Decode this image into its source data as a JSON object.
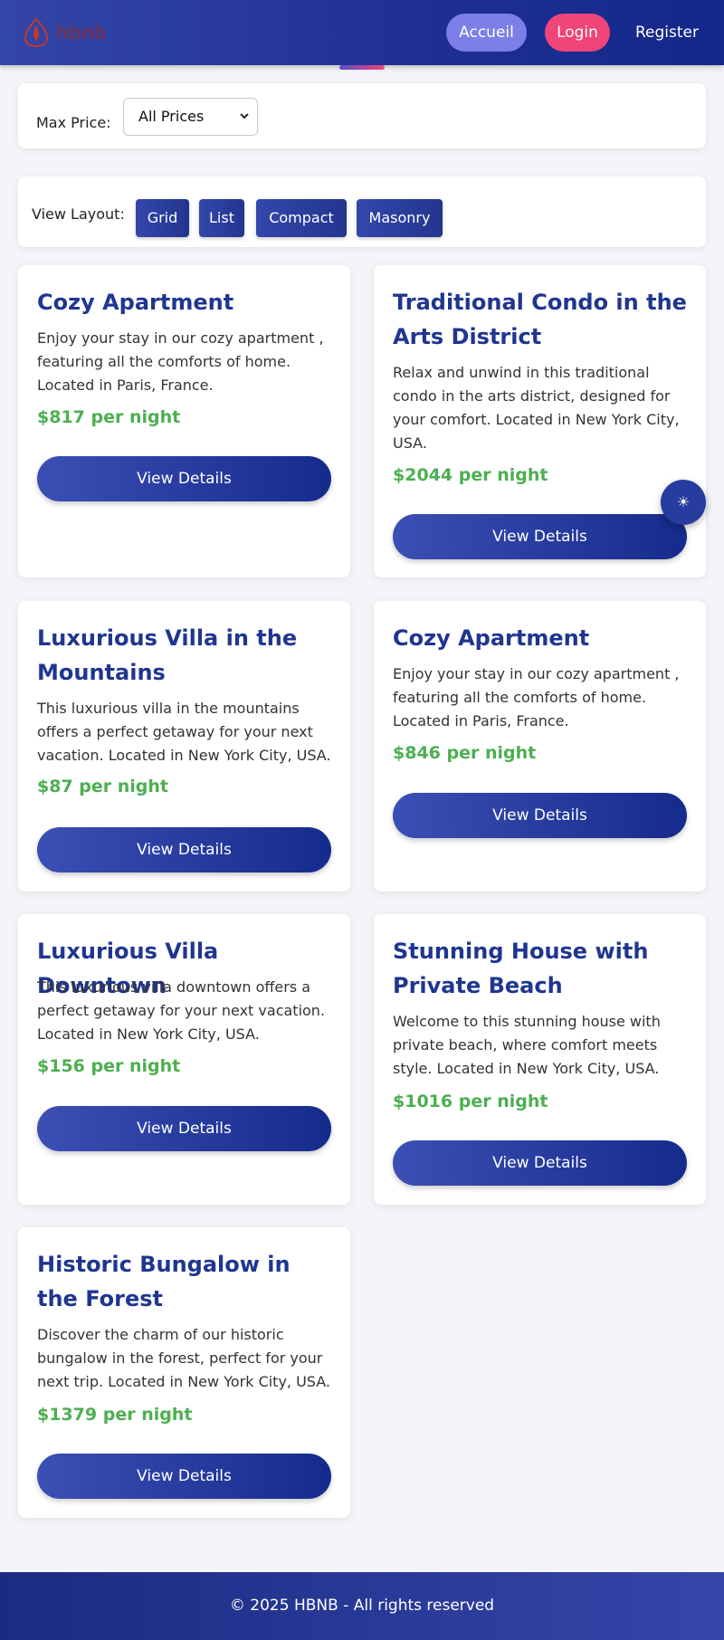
{
  "header": {
    "logo_text": "hbnb",
    "nav": {
      "accueil": "Accueil",
      "login": "Login",
      "register": "Register"
    }
  },
  "filters": {
    "price_label": "Max Price:",
    "price_value": "All Prices",
    "layout_label": "View Layout:",
    "layouts": {
      "grid": "Grid",
      "list": "List",
      "compact": "Compact",
      "masonry": "Masonry"
    }
  },
  "places": [
    {
      "title": "Cozy Apartment",
      "description": "Enjoy your stay in our cozy apartment , featuring all the comforts of home. Located in Paris, France.",
      "price": "$817 per night",
      "button": "View Details"
    },
    {
      "title": "Traditional Condo in the Arts District",
      "description": "Relax and unwind in this traditional condo in the arts district, designed for your comfort. Located in New York City, USA.",
      "price": "$2044 per night",
      "button": "View Details"
    },
    {
      "title": "Luxurious Villa in the Mountains",
      "description": "This luxurious villa in the mountains offers a perfect getaway for your next vacation. Located in New York City, USA.",
      "price": "$87 per night",
      "button": "View Details"
    },
    {
      "title": "Cozy Apartment",
      "description": "Enjoy your stay in our cozy apartment , featuring all the comforts of home. Located in Paris, France.",
      "price": "$846 per night",
      "button": "View Details"
    },
    {
      "title": "Luxurious Villa Downtown",
      "description": "This luxurious villa downtown offers a perfect getaway for your next vacation. Located in New York City, USA.",
      "price": "$156 per night",
      "button": "View Details"
    },
    {
      "title": "Stunning House with Private Beach",
      "description": "Welcome to this stunning house with private beach, where comfort meets style. Located in New York City, USA.",
      "price": "$1016 per night",
      "button": "View Details"
    },
    {
      "title": "Historic Bungalow in the Forest",
      "description": "Discover the charm of our historic bungalow in the forest, perfect for your next trip. Located in New York City, USA.",
      "price": "$1379 per night",
      "button": "View Details"
    }
  ],
  "theme_toggle_icon": "☀",
  "footer": {
    "text": "© 2025 HBNB - All rights reserved"
  }
}
